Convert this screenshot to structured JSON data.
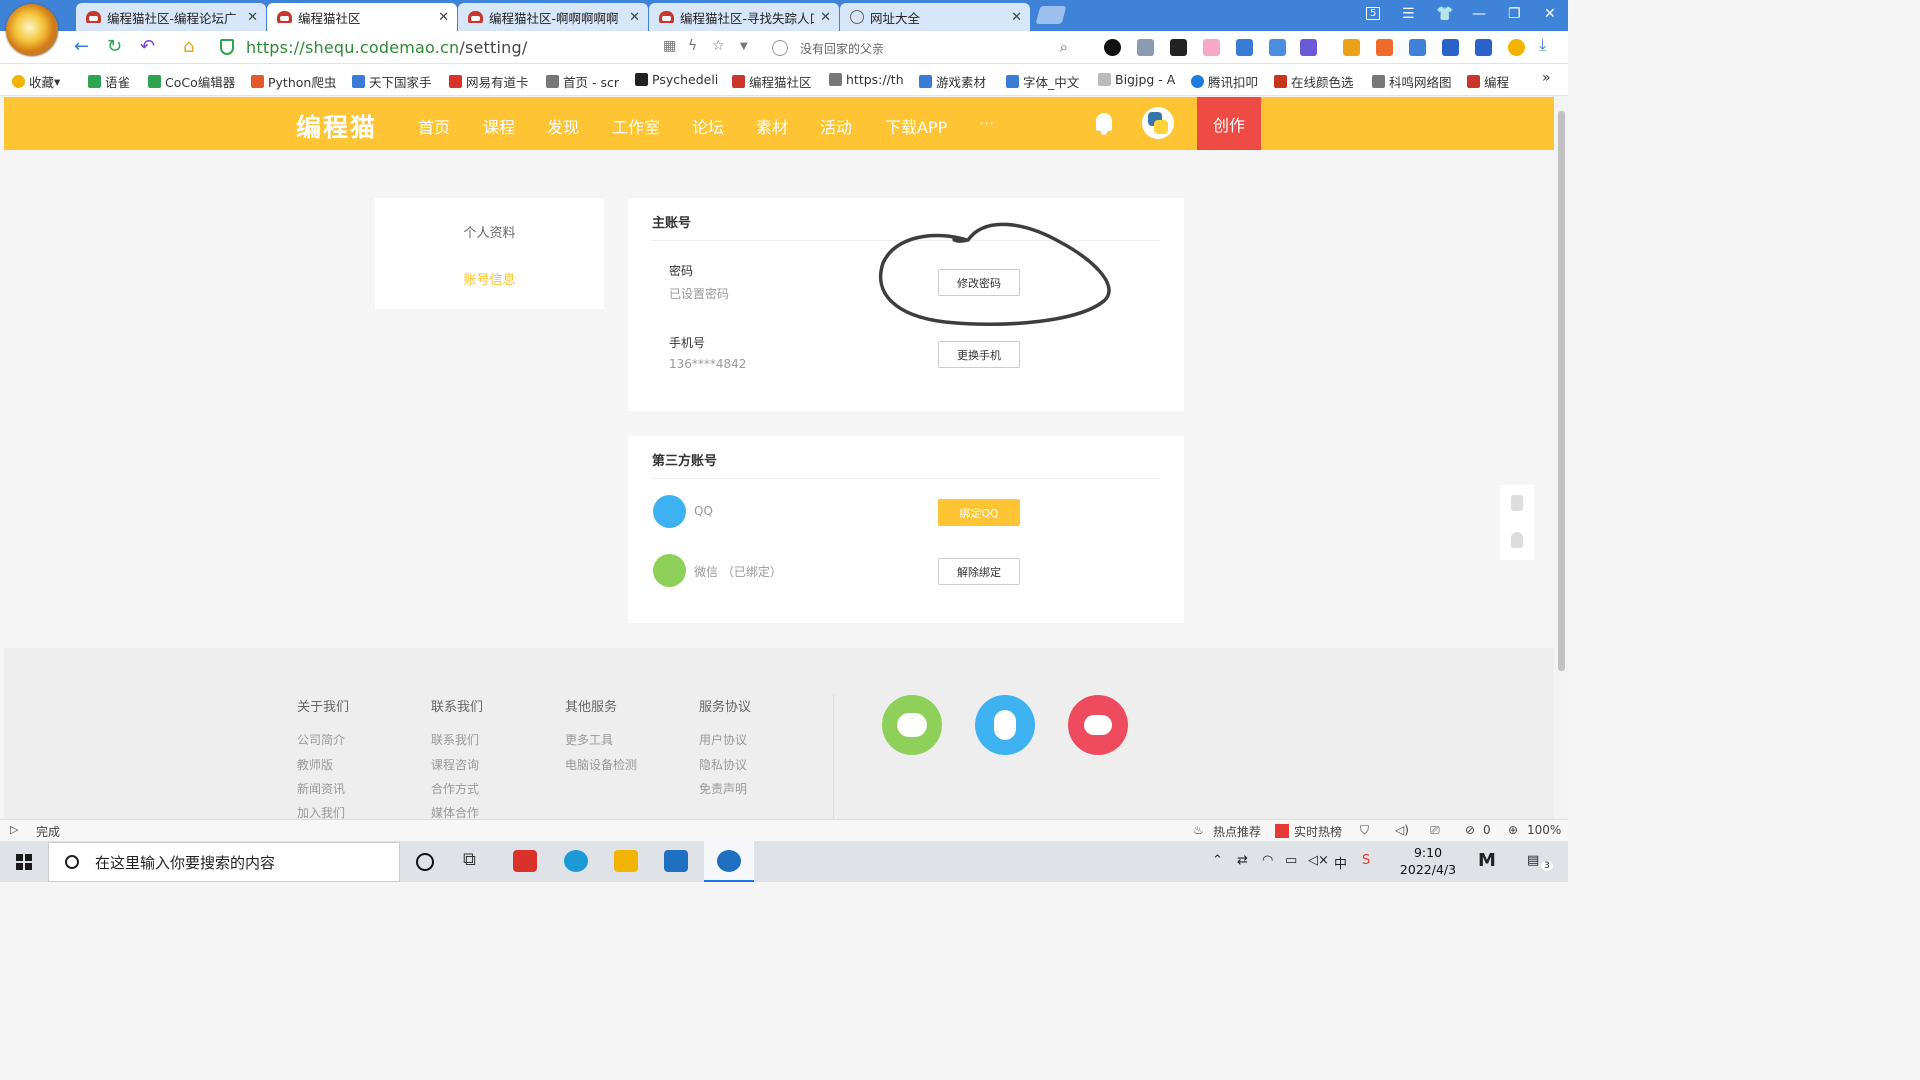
{
  "browser": {
    "tabs": [
      {
        "title": "编程猫社区-编程论坛广",
        "active": false
      },
      {
        "title": "编程猫社区",
        "active": true
      },
      {
        "title": "编程猫社区-啊啊啊啊啊",
        "active": false
      },
      {
        "title": "编程猫社区-寻找失踪人口",
        "active": false
      },
      {
        "title": "网址大全",
        "active": false
      }
    ],
    "tab_counter": "5",
    "url_host": "https://shequ.codemao.cn",
    "url_path": "/setting/",
    "search_placeholder": "没有回家的父亲",
    "bookmarks": [
      "收藏",
      "语雀",
      "CoCo编辑器",
      "Python爬虫",
      "天下国家手",
      "网易有道卡",
      "首页 - scr",
      "Psychedeli",
      "编程猫社区",
      "https://th",
      "游戏素材",
      "字体_中文",
      "Bigjpg - A",
      "腾讯扣叩",
      "在线颜色选",
      "科鸣网络图",
      "编程"
    ]
  },
  "site": {
    "brand": "编程猫",
    "nav": [
      "首页",
      "课程",
      "发现",
      "工作室",
      "论坛",
      "素材",
      "活动",
      "下载APP",
      "···"
    ],
    "create_label": "创作"
  },
  "sidebar": {
    "items": [
      {
        "label": "个人资料",
        "active": false
      },
      {
        "label": "账号信息",
        "active": true
      }
    ]
  },
  "main_account": {
    "title": "主账号",
    "password_label": "密码",
    "password_status": "已设置密码",
    "password_button": "修改密码",
    "phone_label": "手机号",
    "phone_value": "136****4842",
    "phone_button": "更换手机"
  },
  "third_party": {
    "title": "第三方账号",
    "qq_label": "QQ",
    "qq_button": "绑定QQ",
    "wechat_label": "微信 （已绑定）",
    "wechat_button": "解除绑定"
  },
  "footer": {
    "columns": [
      {
        "heading": "关于我们",
        "links": [
          "公司简介",
          "教师版",
          "新闻资讯",
          "加入我们"
        ]
      },
      {
        "heading": "联系我们",
        "links": [
          "联系我们",
          "课程咨询",
          "合作方式",
          "媒体合作"
        ]
      },
      {
        "heading": "其他服务",
        "links": [
          "更多工具",
          "电脑设备检测"
        ]
      },
      {
        "heading": "服务协议",
        "links": [
          "用户协议",
          "隐私协议",
          "免责声明"
        ]
      }
    ],
    "social_colors": [
      "#8ed05a",
      "#3eb2f0",
      "#ee4b5f"
    ]
  },
  "statusbar": {
    "left": "完成",
    "hot": "热点推荐",
    "realtime": "实时热榜",
    "count": "0",
    "zoom": "100%"
  },
  "taskbar": {
    "search_placeholder": "在这里输入你要搜索的内容",
    "time": "9:10",
    "date": "2022/4/3",
    "notif_count": "3"
  },
  "colors": {
    "brand_yellow": "#fec433",
    "create_red": "#ee4b44",
    "browser_blue": "#3f83d8"
  }
}
